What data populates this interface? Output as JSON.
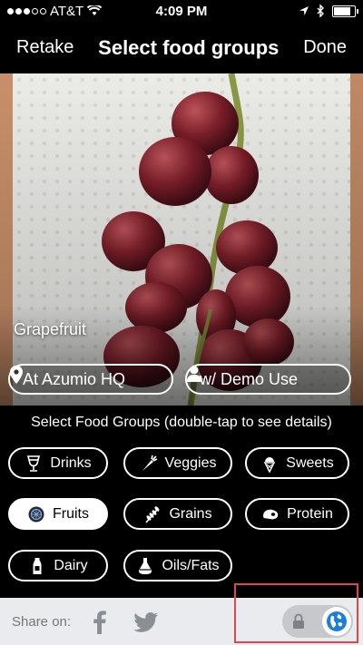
{
  "status_bar": {
    "carrier": "AT&T",
    "time": "4:09 PM",
    "signal_bars_filled": 3,
    "signal_bars_total": 5,
    "battery_level": 0.9
  },
  "nav": {
    "left_label": "Retake",
    "title": "Select food groups",
    "right_label": "Done"
  },
  "photo": {
    "food_name": "Grapefruit",
    "location_label": "At Azumio HQ",
    "people_label": "w/ Demo Use"
  },
  "food_groups": {
    "title": "Select Food Groups (double-tap to see details)",
    "items": [
      {
        "label": "Drinks",
        "icon": "glass-icon",
        "selected": false
      },
      {
        "label": "Veggies",
        "icon": "carrot-icon",
        "selected": false
      },
      {
        "label": "Sweets",
        "icon": "ice-cream-icon",
        "selected": false
      },
      {
        "label": "Fruits",
        "icon": "fruit-icon",
        "selected": true
      },
      {
        "label": "Grains",
        "icon": "wheat-icon",
        "selected": false
      },
      {
        "label": "Protein",
        "icon": "meat-icon",
        "selected": false
      },
      {
        "label": "Dairy",
        "icon": "milk-bottle-icon",
        "selected": false
      },
      {
        "label": "Oils/Fats",
        "icon": "oil-flask-icon",
        "selected": false
      }
    ]
  },
  "share": {
    "label": "Share on:",
    "targets": [
      "facebook-icon",
      "twitter-icon"
    ],
    "privacy_toggle": {
      "left_icon": "lock-icon",
      "right_icon": "globe-icon",
      "selected": "public"
    }
  },
  "colors": {
    "background": "#000000",
    "share_bar": "#e9ebee",
    "globe_blue": "#1d7ed8",
    "highlight": "#e0474c"
  }
}
